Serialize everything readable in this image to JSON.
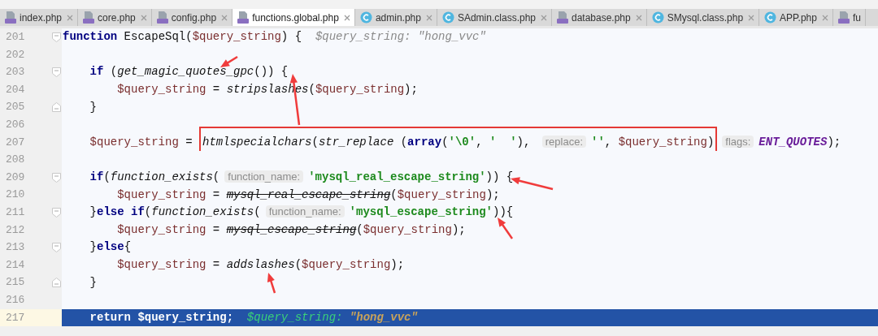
{
  "tabs": [
    {
      "label": "index.php",
      "kind": "php",
      "selected": false,
      "closable": true
    },
    {
      "label": "core.php",
      "kind": "php",
      "selected": false,
      "closable": true
    },
    {
      "label": "config.php",
      "kind": "php",
      "selected": false,
      "closable": true
    },
    {
      "label": "functions.global.php",
      "kind": "php",
      "selected": true,
      "closable": true
    },
    {
      "label": "admin.php",
      "kind": "class",
      "selected": false,
      "closable": true
    },
    {
      "label": "SAdmin.class.php",
      "kind": "class",
      "selected": false,
      "closable": true
    },
    {
      "label": "database.php",
      "kind": "php",
      "selected": false,
      "closable": true
    },
    {
      "label": "SMysql.class.php",
      "kind": "class",
      "selected": false,
      "closable": true
    },
    {
      "label": "APP.php",
      "kind": "class",
      "selected": false,
      "closable": true
    },
    {
      "label": "fu",
      "kind": "php",
      "selected": false,
      "closable": false
    }
  ],
  "lines": [
    {
      "number": "201",
      "kind": "fold-open",
      "selected": false,
      "tokens": [
        {
          "kind": "keyword",
          "text": "function"
        },
        {
          "kind": "plain",
          "text": " EscapeSql("
        },
        {
          "kind": "var",
          "text": "$query_string"
        },
        {
          "kind": "plain",
          "text": ") {  "
        },
        {
          "kind": "inlay",
          "text": "$query_string: \"hong_vvc\""
        }
      ]
    },
    {
      "number": "202",
      "kind": "plain",
      "selected": false
    },
    {
      "number": "203",
      "kind": "fold-open",
      "selected": false,
      "tokens": [
        {
          "kind": "keyword",
          "text": "    if"
        },
        {
          "kind": "plain",
          "text": " ("
        },
        {
          "kind": "func",
          "text": "get_magic_quotes_gpc"
        },
        {
          "kind": "plain",
          "text": "()) {"
        }
      ]
    },
    {
      "number": "204",
      "kind": "plain",
      "selected": false,
      "tokens": [
        {
          "kind": "var",
          "text": "        $query_string"
        },
        {
          "kind": "plain",
          "text": " = "
        },
        {
          "kind": "func",
          "text": "stripslashes"
        },
        {
          "kind": "plain",
          "text": "("
        },
        {
          "kind": "var",
          "text": "$query_string"
        },
        {
          "kind": "plain",
          "text": ");"
        }
      ]
    },
    {
      "number": "205",
      "kind": "fold-close",
      "selected": false,
      "tokens": [
        {
          "kind": "plain",
          "text": "    }"
        }
      ]
    },
    {
      "number": "206",
      "kind": "plain",
      "selected": false
    },
    {
      "number": "207",
      "kind": "plain",
      "selected": false,
      "tokens": [
        {
          "kind": "var",
          "text": "    $query_string"
        },
        {
          "kind": "plain",
          "text": " = "
        },
        {
          "kind": "box",
          "tokens": [
            {
              "kind": "func",
              "text": "htmlspecialchars"
            },
            {
              "kind": "plain",
              "text": "("
            },
            {
              "kind": "func",
              "text": "str_replace"
            },
            {
              "kind": "plain",
              "text": " ("
            },
            {
              "kind": "keyword",
              "text": "array"
            },
            {
              "kind": "plain",
              "text": "("
            },
            {
              "kind": "string",
              "text": "'\\0'"
            },
            {
              "kind": "plain",
              "text": ", "
            },
            {
              "kind": "string",
              "text": "'  '"
            },
            {
              "kind": "plain",
              "text": "), "
            },
            {
              "kind": "hint",
              "text": "replace:"
            },
            {
              "kind": "string",
              "text": "''"
            },
            {
              "kind": "plain",
              "text": ", "
            },
            {
              "kind": "var",
              "text": "$query_string"
            },
            {
              "kind": "plain",
              "text": ")"
            }
          ]
        },
        {
          "kind": "hint",
          "text": "flags:"
        },
        {
          "kind": "const",
          "text": "ENT_QUOTES"
        },
        {
          "kind": "plain",
          "text": ");"
        }
      ]
    },
    {
      "number": "208",
      "kind": "plain",
      "selected": false
    },
    {
      "number": "209",
      "kind": "fold-open",
      "selected": false,
      "tokens": [
        {
          "kind": "keyword",
          "text": "    if"
        },
        {
          "kind": "plain",
          "text": "("
        },
        {
          "kind": "func",
          "text": "function_exists"
        },
        {
          "kind": "plain",
          "text": "("
        },
        {
          "kind": "hint",
          "text": "function_name:"
        },
        {
          "kind": "string",
          "text": "'mysql_real_escape_string'"
        },
        {
          "kind": "plain",
          "text": ")) {"
        }
      ]
    },
    {
      "number": "210",
      "kind": "plain",
      "selected": false,
      "tokens": [
        {
          "kind": "var",
          "text": "        $query_string"
        },
        {
          "kind": "plain",
          "text": " = "
        },
        {
          "kind": "deprecated",
          "text": "mysql_real_escape_string"
        },
        {
          "kind": "plain",
          "text": "("
        },
        {
          "kind": "var",
          "text": "$query_string"
        },
        {
          "kind": "plain",
          "text": ");"
        }
      ]
    },
    {
      "number": "211",
      "kind": "fold-open",
      "selected": false,
      "tokens": [
        {
          "kind": "plain",
          "text": "    }"
        },
        {
          "kind": "keyword",
          "text": "else if"
        },
        {
          "kind": "plain",
          "text": "("
        },
        {
          "kind": "func",
          "text": "function_exists"
        },
        {
          "kind": "plain",
          "text": "("
        },
        {
          "kind": "hint",
          "text": "function_name:"
        },
        {
          "kind": "string",
          "text": "'mysql_escape_string'"
        },
        {
          "kind": "plain",
          "text": ")){"
        }
      ]
    },
    {
      "number": "212",
      "kind": "plain",
      "selected": false,
      "tokens": [
        {
          "kind": "var",
          "text": "        $query_string"
        },
        {
          "kind": "plain",
          "text": " = "
        },
        {
          "kind": "deprecated",
          "text": "mysql_escape_string"
        },
        {
          "kind": "plain",
          "text": "("
        },
        {
          "kind": "var",
          "text": "$query_string"
        },
        {
          "kind": "plain",
          "text": ");"
        }
      ]
    },
    {
      "number": "213",
      "kind": "fold-open",
      "selected": false,
      "tokens": [
        {
          "kind": "plain",
          "text": "    }"
        },
        {
          "kind": "keyword",
          "text": "else"
        },
        {
          "kind": "plain",
          "text": "{"
        }
      ]
    },
    {
      "number": "214",
      "kind": "plain",
      "selected": false,
      "tokens": [
        {
          "kind": "var",
          "text": "        $query_string"
        },
        {
          "kind": "plain",
          "text": " = "
        },
        {
          "kind": "func",
          "text": "addslashes"
        },
        {
          "kind": "plain",
          "text": "("
        },
        {
          "kind": "var",
          "text": "$query_string"
        },
        {
          "kind": "plain",
          "text": ");"
        }
      ]
    },
    {
      "number": "215",
      "kind": "fold-close",
      "selected": false,
      "tokens": [
        {
          "kind": "plain",
          "text": "    }"
        }
      ]
    },
    {
      "number": "216",
      "kind": "plain",
      "selected": false
    },
    {
      "number": "217",
      "kind": "plain",
      "selected": true,
      "tokens": [
        {
          "kind": "keyword",
          "text": "    return"
        },
        {
          "kind": "plain",
          "text": " $query_string;  "
        },
        {
          "kind": "inlay-name",
          "text": "$query_string: "
        },
        {
          "kind": "inlay-value",
          "text": "\"hong_vvc\""
        }
      ]
    }
  ]
}
